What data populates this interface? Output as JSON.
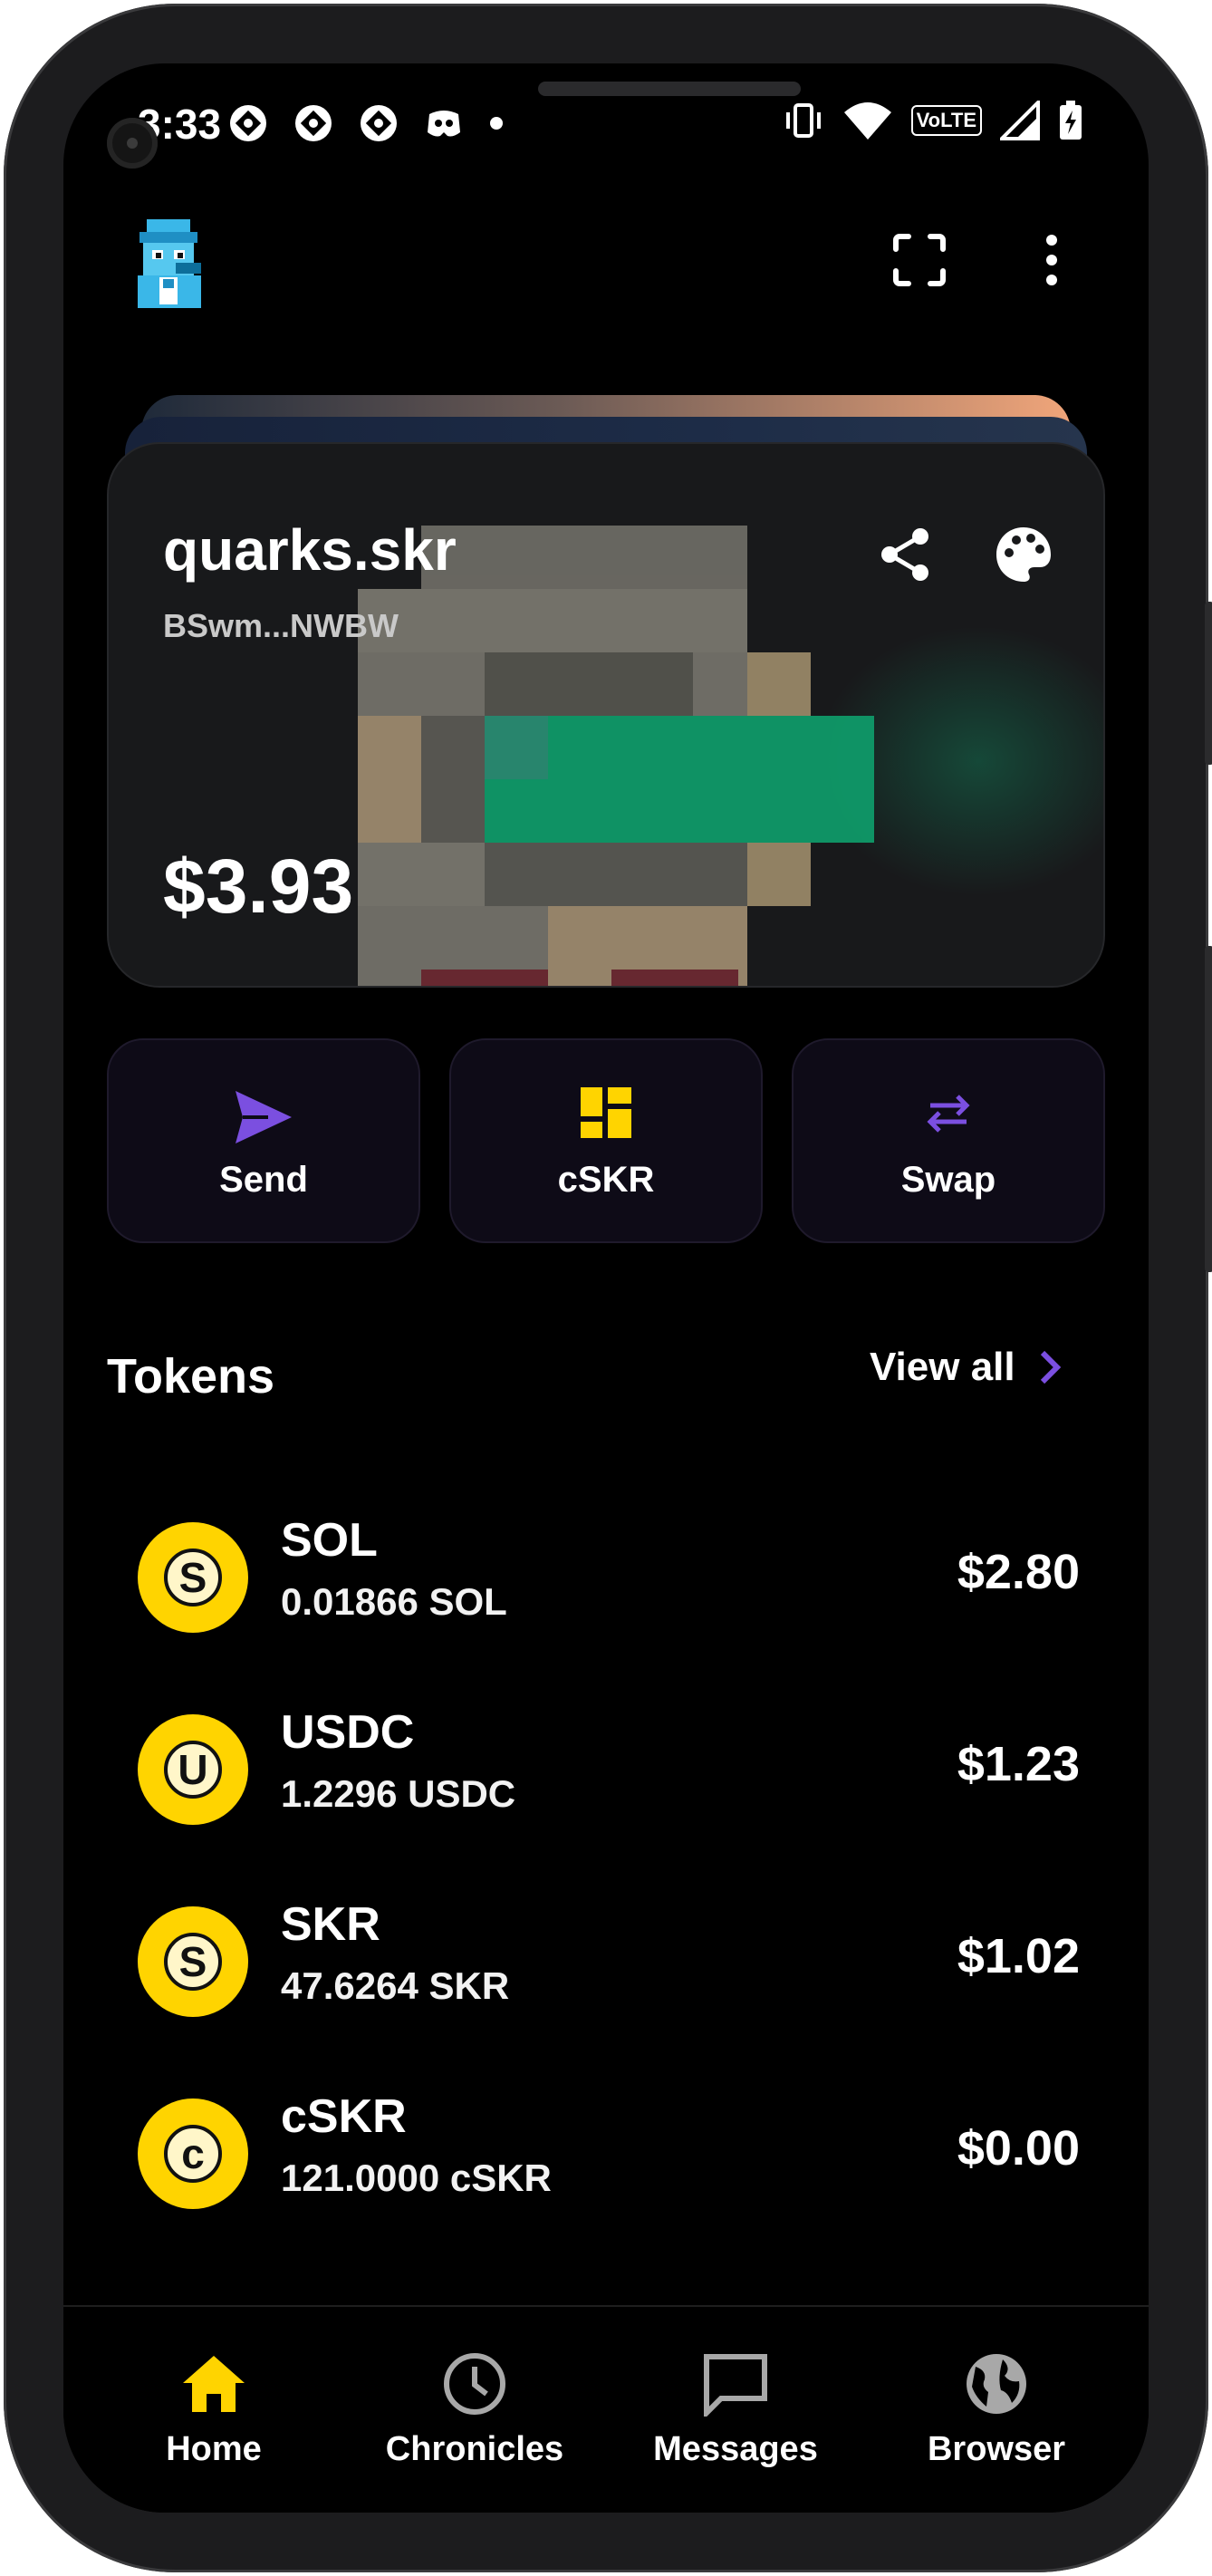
{
  "status_bar": {
    "time": "3:33",
    "network": "VoLTE"
  },
  "header": {
    "avatar_icon": "pixel-avatar-icon",
    "scan_icon": "scan-frame-icon",
    "menu_icon": "more-vert-icon"
  },
  "wallet_card": {
    "name": "quarks.skr",
    "address": "BSwm...NWBW",
    "balance": "$3.93",
    "share_icon": "share-icon",
    "theme_icon": "palette-icon"
  },
  "actions": [
    {
      "label": "Send",
      "icon": "send-icon",
      "color": "#7b4fe0"
    },
    {
      "label": "cSKR",
      "icon": "dashboard-icon",
      "color": "#ffd400"
    },
    {
      "label": "Swap",
      "icon": "swap-icon",
      "color": "#7b4fe0"
    }
  ],
  "tokens": {
    "title": "Tokens",
    "view_all": "View all",
    "items": [
      {
        "letter": "S",
        "symbol": "SOL",
        "amount": "0.01866 SOL",
        "value": "$2.80"
      },
      {
        "letter": "U",
        "symbol": "USDC",
        "amount": "1.2296 USDC",
        "value": "$1.23"
      },
      {
        "letter": "S",
        "symbol": "SKR",
        "amount": "47.6264 SKR",
        "value": "$1.02"
      },
      {
        "letter": "c",
        "symbol": "cSKR",
        "amount": "121.0000 cSKR",
        "value": "$0.00"
      }
    ]
  },
  "nav": [
    {
      "label": "Home",
      "icon": "home-icon",
      "active": true
    },
    {
      "label": "Chronicles",
      "icon": "clock-icon",
      "active": false
    },
    {
      "label": "Messages",
      "icon": "chat-icon",
      "active": false
    },
    {
      "label": "Browser",
      "icon": "globe-icon",
      "active": false
    }
  ],
  "colors": {
    "accent_yellow": "#ffd400",
    "accent_purple": "#7b4fe0",
    "background": "#000000"
  }
}
